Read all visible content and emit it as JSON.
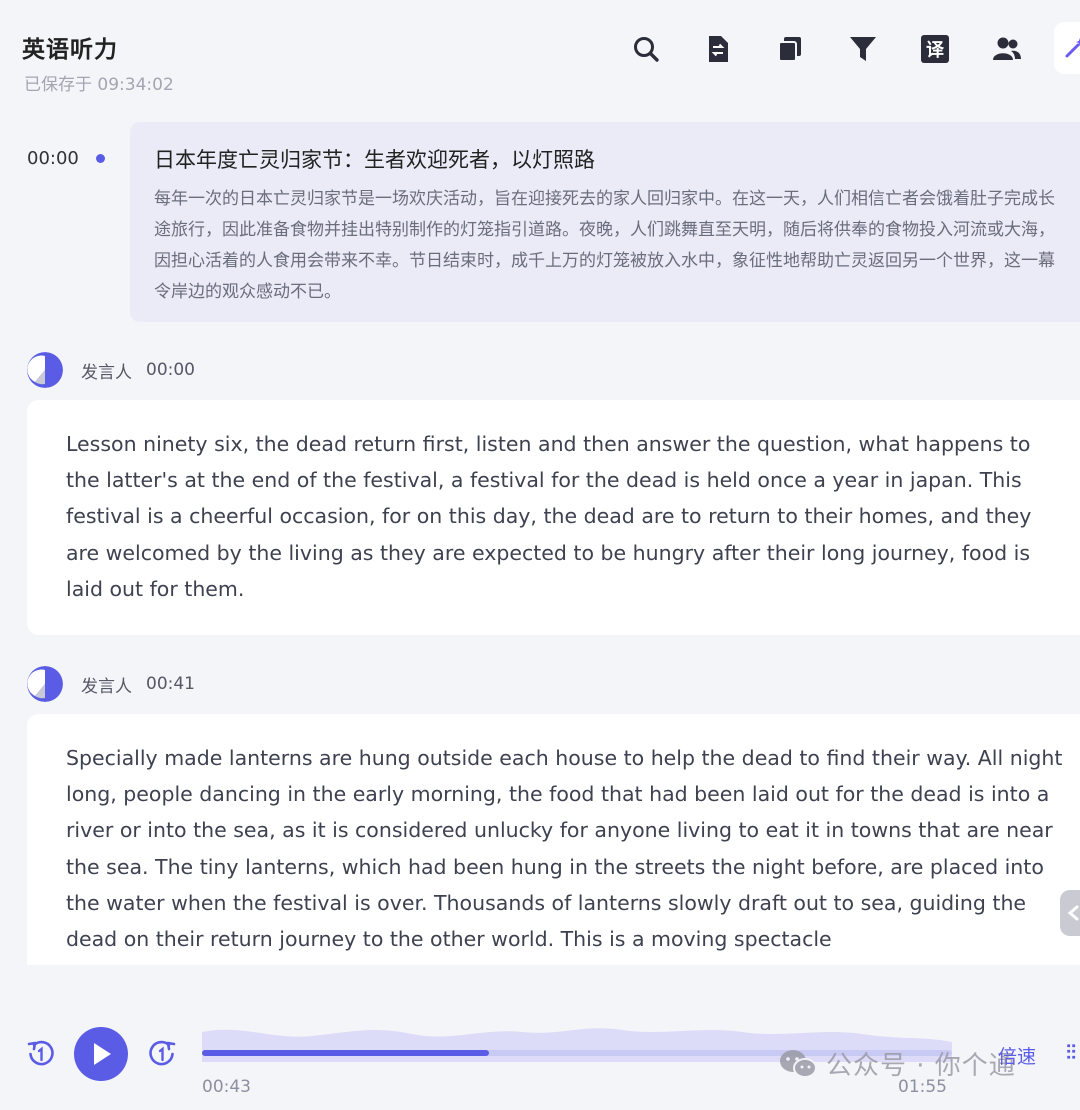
{
  "header": {
    "title": "英语听力",
    "saved_text": "已保存于 09:34:02"
  },
  "toolbar": {
    "icons": [
      "search-icon",
      "file-transfer-icon",
      "copy-pages-icon",
      "filter-icon",
      "translate-icon",
      "users-icon",
      "magic-wand-icon"
    ],
    "translate_glyph": "译"
  },
  "summary": {
    "timestamp": "00:00",
    "title": "日本年度亡灵归家节：生者欢迎死者，以灯照路",
    "body": "每年一次的日本亡灵归家节是一场欢庆活动，旨在迎接死去的家人回归家中。在这一天，人们相信亡者会饿着肚子完成长途旅行，因此准备食物并挂出特别制作的灯笼指引道路。夜晚，人们跳舞直至天明，随后将供奉的食物投入河流或大海，因担心活着的人食用会带来不幸。节日结束时，成千上万的灯笼被放入水中，象征性地帮助亡灵返回另一个世界，这一幕令岸边的观众感动不已。"
  },
  "segments": [
    {
      "speaker": "发言人",
      "time": "00:00",
      "text": "Lesson ninety six, the dead return first, listen and then answer the question, what happens to the latter's at the end of the festival, a festival for the dead is held once a year in japan. This festival is a cheerful occasion, for on this day, the dead are to return to their homes, and they are welcomed by the living as they are expected to be hungry after their long journey, food is laid out for them."
    },
    {
      "speaker": "发言人",
      "time": "00:41",
      "text": "Specially made lanterns are hung outside each house to help the dead to find their way. All night long, people dancing in the early morning, the food that had been laid out for the dead is into a river or into the sea, as it is considered unlucky for anyone living to eat it in towns that are near the sea. The tiny lanterns, which had been hung in the streets the night before, are placed into the water when the festival is over. Thousands of lanterns slowly draft out to sea, guiding the dead on their return journey to the other world. This is a moving spectacle"
    }
  ],
  "player": {
    "current_time": "00:43",
    "total_time": "01:55",
    "progress": 0.382,
    "speed_label": "倍速",
    "eq_glyph": "⫶⫶"
  },
  "watermark": {
    "text": "公众号 · 你个通"
  },
  "colors": {
    "accent": "#5b5ce6",
    "background": "#f4f5f9",
    "summary_bg": "#ebebf7"
  }
}
